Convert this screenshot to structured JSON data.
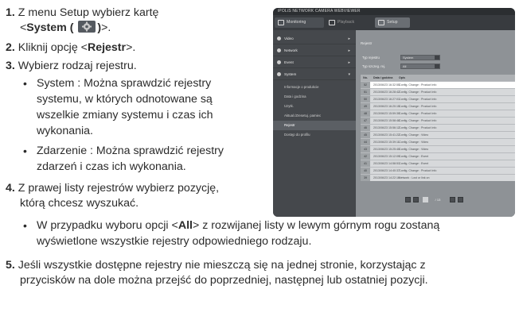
{
  "steps": [
    {
      "num": "1.",
      "line1": "Z menu Setup wybierz kartę",
      "line2_pre": "<",
      "line2_bold": "System (",
      "line2_bold2": ")",
      "line2_post": ">."
    },
    {
      "num": "2.",
      "pre": "Kliknij opcję <",
      "bold": "Rejestr",
      "post": ">."
    },
    {
      "num": "3.",
      "text": "Wybierz rodzaj rejestru."
    },
    {
      "num": "4.",
      "line1": "Z prawej listy rejestrów wybierz pozycję,",
      "line2": "którą chcesz wyszukać."
    },
    {
      "num": "5.",
      "line1": "Jeśli wszystkie dostępne rejestry nie mieszczą się na jednej stronie, korzystając z",
      "line2": "przycisków na dole można przejść do poprzedniej, następnej lub ostatniej pozycji."
    }
  ],
  "step3_bullets": [
    [
      "System : Można sprawdzić rejestry",
      "systemu, w których odnotowane są",
      "wszelkie zmiany systemu i czas ich",
      "wykonania."
    ],
    [
      "Zdarzenie : Można sprawdzić rejestry",
      "zdarzeń i czas ich wykonania."
    ]
  ],
  "step4_bullet": {
    "line1_pre": "W przypadku wyboru opcji <",
    "line1_bold": "All",
    "line1_post": "> z rozwijanej listy w lewym górnym rogu zostaną",
    "line2": "wyświetlone wszystkie rejestry odpowiedniego rodzaju."
  },
  "bullet_char": "•",
  "icons": {
    "system": "gear-icon"
  },
  "screenshot": {
    "title": "iPOLiS NETWORK CAMERA WEBVIEWER",
    "tabs": [
      "Monitoring",
      "Playback",
      "Setup"
    ],
    "menu": [
      {
        "label": "Video",
        "arrow": "▸"
      },
      {
        "label": "Network",
        "arrow": "▸"
      },
      {
        "label": "Event",
        "arrow": "▸"
      },
      {
        "label": "System",
        "arrow": "▾"
      }
    ],
    "submenu": [
      "Informacje o produkcie",
      "Data i godzina",
      "Uzytk.",
      "Aktual./Zresetuj. pamiec",
      "Rejestr",
      "Dostęp do profilu"
    ],
    "submenu_active": 4,
    "breadcrumb": "Rejestr",
    "filters": [
      {
        "label": "Typ rejestru",
        "value": "System"
      },
      {
        "label": "Typ szczeg. rej.",
        "value": "All"
      }
    ],
    "table_head": [
      "No.",
      "Data i godzina",
      "Opis",
      ""
    ],
    "table_rows": [
      [
        "52",
        "2013/06/23 16:32:55",
        "Config. Change : Product Info"
      ],
      [
        "51",
        "2013/06/23 16:28:42",
        "Config. Change : Product Info"
      ],
      [
        "50",
        "2013/06/23 16:27:01",
        "Config. Change : Product Info"
      ],
      [
        "49",
        "2013/06/23 16:20:15",
        "Config. Change : Product Info"
      ],
      [
        "48",
        "2013/06/23 15:59:30",
        "Config. Change : Product Info"
      ],
      [
        "47",
        "2013/06/23 15:58:48",
        "Config. Change : Product Info"
      ],
      [
        "46",
        "2013/06/23 15:56:12",
        "Config. Change : Product Info"
      ],
      [
        "45",
        "2013/06/23 15:41:22",
        "Config. Change : Video"
      ],
      [
        "44",
        "2013/06/23 15:39:11",
        "Config. Change : Video"
      ],
      [
        "43",
        "2013/06/23 15:25:40",
        "Config. Change : Video"
      ],
      [
        "42",
        "2013/06/23 15:12:09",
        "Config. Change : Event"
      ],
      [
        "41",
        "2013/06/23 14:58:51",
        "Config. Change : Event"
      ],
      [
        "40",
        "2013/06/23 14:40:37",
        "Config. Change : Product Info"
      ],
      [
        "39",
        "2013/06/23 14:22:16",
        "Network : Lost or link on"
      ]
    ],
    "selected_row": 0,
    "pager_text": "/ 13"
  },
  "colors": {
    "text": "#2b2b2b",
    "screenshot_bg": "#5a5d61"
  }
}
